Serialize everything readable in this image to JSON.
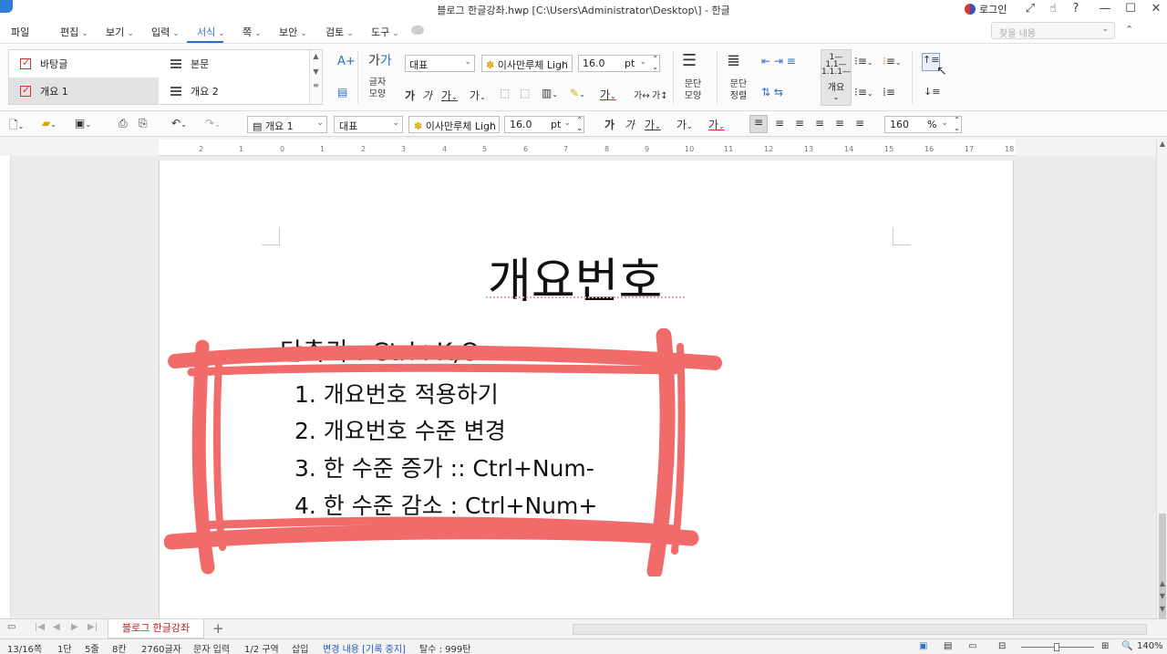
{
  "window": {
    "title": "블로그 한글강좌.hwp [C:\\Users\\Administrator\\Desktop\\] - 한글",
    "login_label": "로그인"
  },
  "menu": {
    "items": [
      {
        "label": "파일",
        "has_dropdown": false
      },
      {
        "label": "편집",
        "has_dropdown": true
      },
      {
        "label": "보기",
        "has_dropdown": true
      },
      {
        "label": "입력",
        "has_dropdown": true
      },
      {
        "label": "서식",
        "has_dropdown": true,
        "active": true
      },
      {
        "label": "쪽",
        "has_dropdown": true
      },
      {
        "label": "보안",
        "has_dropdown": true
      },
      {
        "label": "검토",
        "has_dropdown": true
      },
      {
        "label": "도구",
        "has_dropdown": true
      }
    ],
    "find_placeholder": "찾을 내용"
  },
  "ribbon": {
    "styles": [
      {
        "label": "바탕글",
        "icon": "check-icon",
        "selected": false
      },
      {
        "label": "본문",
        "icon": "lines-icon",
        "selected": false
      },
      {
        "label": "개요 1",
        "icon": "check-icon",
        "selected": true
      },
      {
        "label": "개요 2",
        "icon": "lines-icon",
        "selected": false
      }
    ],
    "font_shape_label_1": "글자",
    "font_shape_label_2": "모양",
    "font_group": "대표",
    "font_name": "이사만루체 Ligh",
    "font_size": "16.0",
    "font_unit": "pt",
    "para_shape_label_1": "문단",
    "para_shape_label_2": "모양",
    "para_align_label_1": "문단",
    "para_align_label_2": "정렬",
    "outline_label": "개요",
    "bold_glyph": "가",
    "italic_glyph": "가",
    "underline_glyph": "가",
    "strike_glyph": "가",
    "color_glyph": "가",
    "superscript_glyph": "가"
  },
  "toolbar": {
    "style_value": "개요 1",
    "font_group": "대표",
    "font_name": "이사만루체 Ligh",
    "font_size": "16.0",
    "font_unit": "pt",
    "zoom_value": "160",
    "zoom_unit": "%",
    "bold_glyph": "가",
    "italic_glyph": "가",
    "underline_glyph": "가",
    "strike_glyph": "가",
    "color_glyph": "가"
  },
  "ruler": {
    "ticks": [
      "2",
      "1",
      "0",
      "1",
      "2",
      "3",
      "4",
      "5",
      "6",
      "7",
      "8",
      "9",
      "10",
      "11",
      "12",
      "13",
      "14",
      "15",
      "16",
      "17",
      "18"
    ]
  },
  "document": {
    "title": "개요번호",
    "shortcut": "단축키 : Ctrl+K,O",
    "items": [
      "1. 개요번호 적용하기",
      "2. 개요번호 수준 변경",
      "3. 한 수준 증가 :: Ctrl+Num-",
      "4. 한 수준 감소 : Ctrl+Num+"
    ],
    "highlight_color": "#f26b6b"
  },
  "tabs": {
    "document_tab": "블로그 한글강좌",
    "add_label": "+"
  },
  "status": {
    "page": "13/16쪽",
    "column": "1단",
    "line": "5줄",
    "char": "8칸",
    "count": "2760글자",
    "input_mode": "문자 입력",
    "section": "1/2 구역",
    "insert": "삽입",
    "track_changes": "변경 내용 [기록 중지]",
    "prohibited": "탈수 : 999탄",
    "zoom": "140%"
  }
}
